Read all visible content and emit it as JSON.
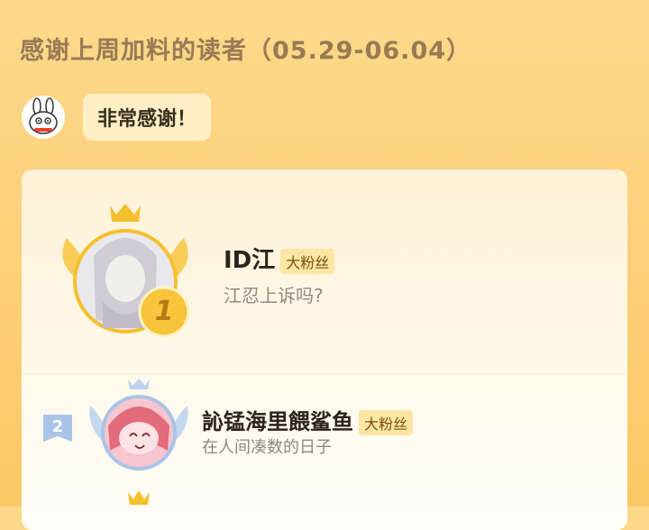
{
  "header": {
    "title": "感谢上周加料的读者（05.29-06.04）"
  },
  "mascot": {
    "icon": "bunny-mascot-icon",
    "bubble_text": "非常感谢！"
  },
  "ranking": [
    {
      "rank": "1",
      "name": "ID江",
      "badge": "大粉丝",
      "motto": "江忍上诉吗?",
      "icon": "crown-icon"
    },
    {
      "rank": "2",
      "name": "訫锰海里餵鲨鱼",
      "badge": "大粉丝",
      "motto": "在人间凑数的日子",
      "icon": "crown-icon"
    }
  ],
  "colors": {
    "background": "#fdd17c",
    "title": "#9a7a55",
    "badge_bg": "#fde6a3",
    "gold": "#f5c02d",
    "silver_blue": "#a9c4e6"
  }
}
